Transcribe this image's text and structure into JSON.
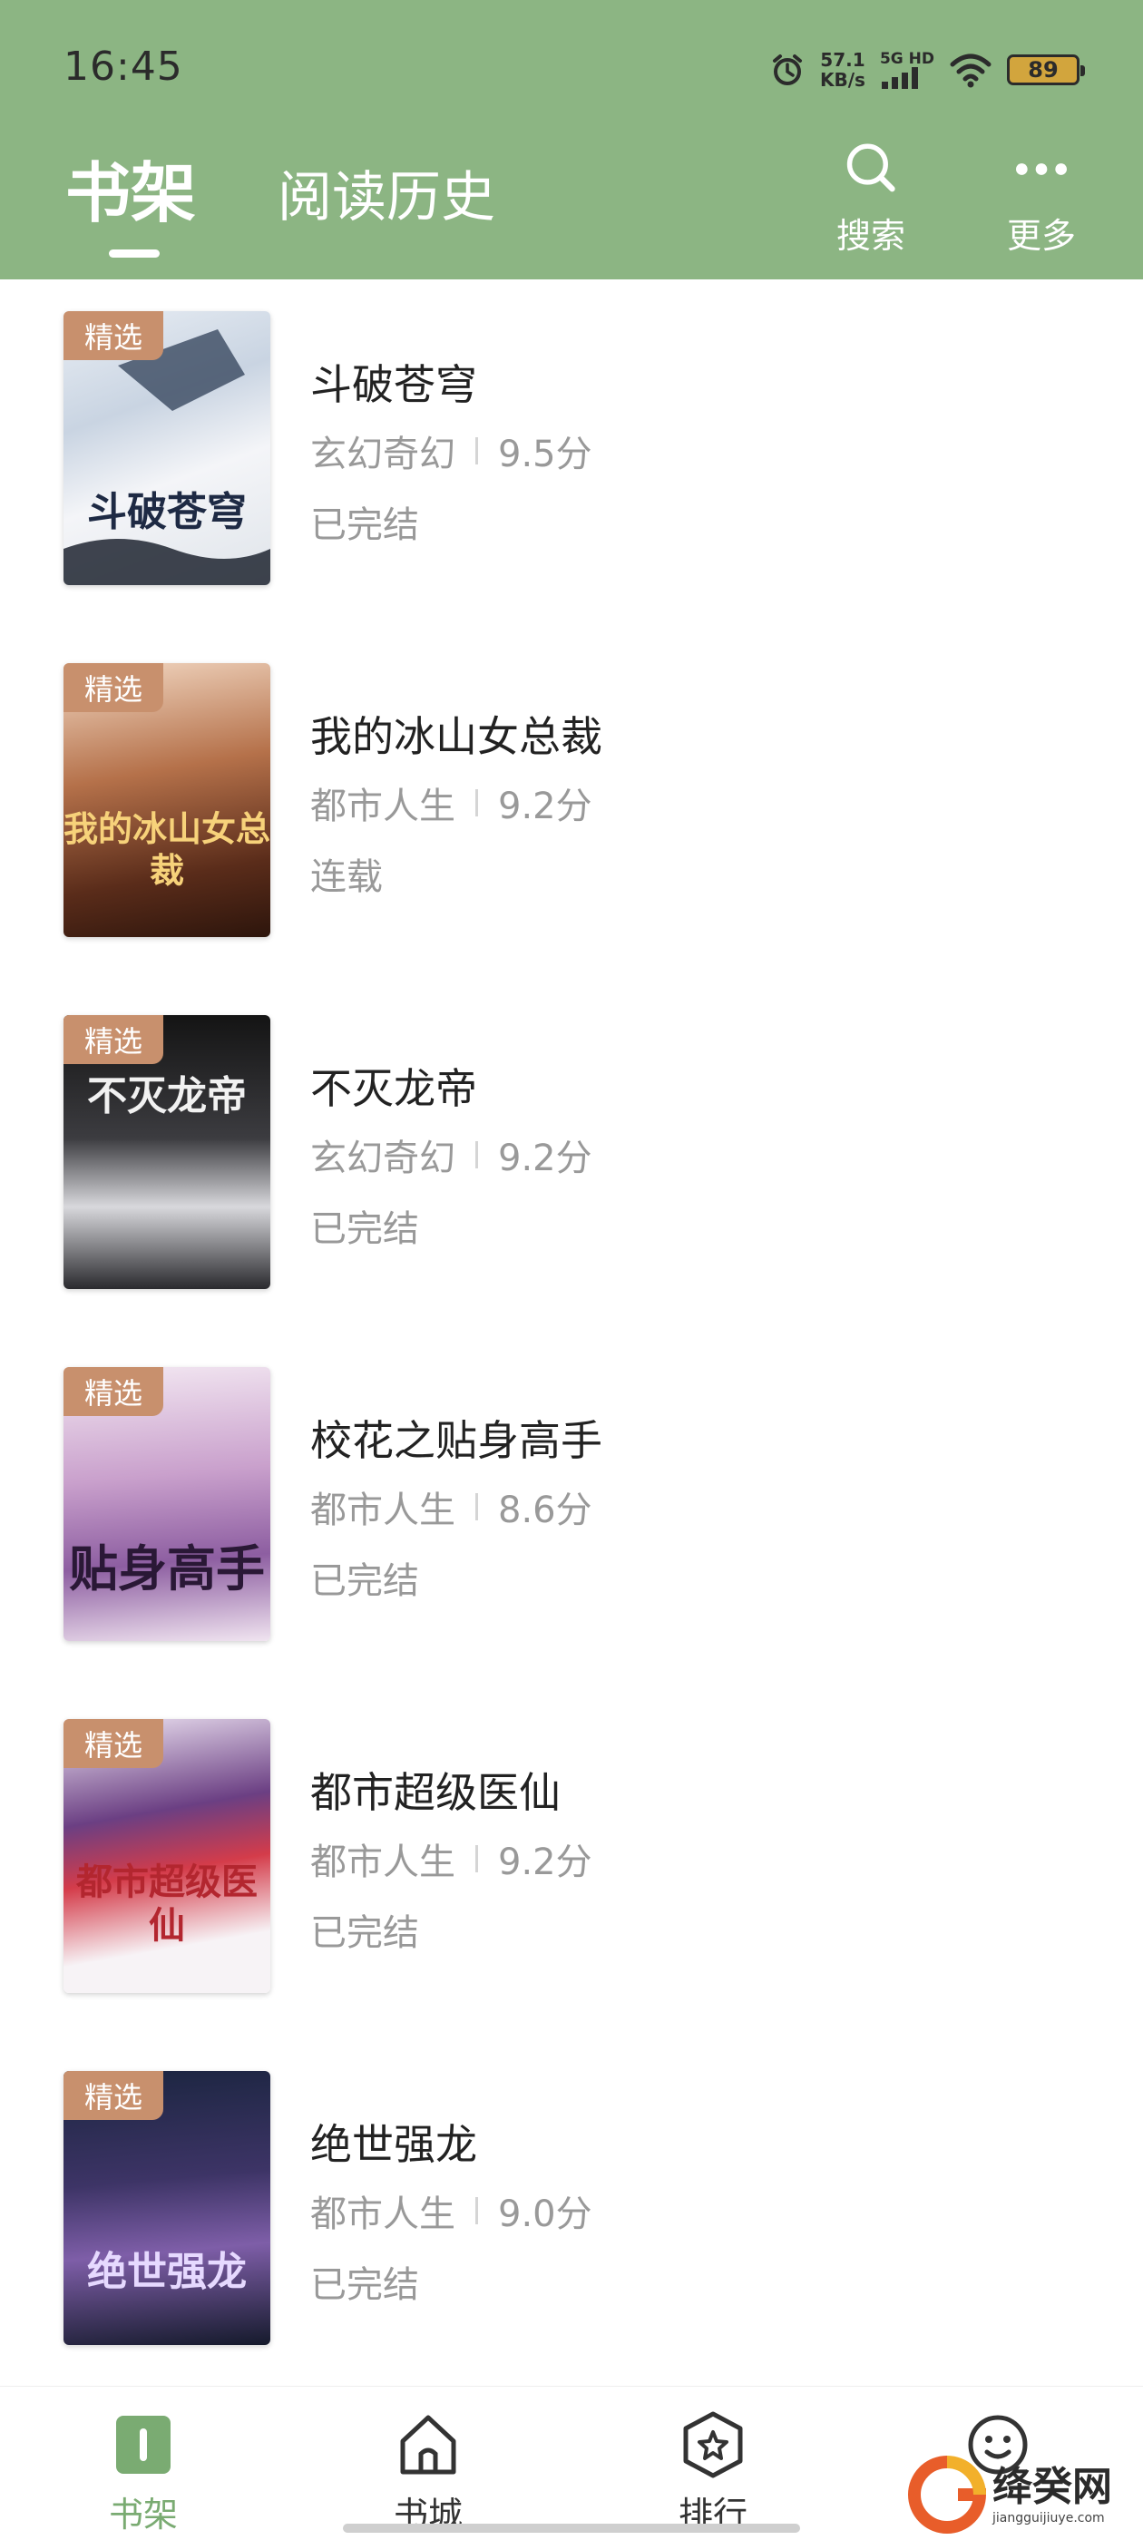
{
  "status_bar": {
    "time": "16:45",
    "net_speed_value": "57.1",
    "net_speed_unit": "KB/s",
    "signal_label": "5G HD",
    "battery": "89"
  },
  "header": {
    "tabs": [
      {
        "label": "书架",
        "active": true
      },
      {
        "label": "阅读历史",
        "active": false
      }
    ],
    "search_label": "搜索",
    "more_label": "更多",
    "accent_color": "#8cb583"
  },
  "books": [
    {
      "badge": "精选",
      "title": "斗破苍穹",
      "genre": "玄幻奇幻",
      "score": "9.5分",
      "status": "已完结",
      "cover_text": "斗破苍穹"
    },
    {
      "badge": "精选",
      "title": "我的冰山女总裁",
      "genre": "都市人生",
      "score": "9.2分",
      "status": "连载",
      "cover_text": "我的冰山女总裁"
    },
    {
      "badge": "精选",
      "title": "不灭龙帝",
      "genre": "玄幻奇幻",
      "score": "9.2分",
      "status": "已完结",
      "cover_text": "不灭龙帝"
    },
    {
      "badge": "精选",
      "title": "校花之贴身高手",
      "genre": "都市人生",
      "score": "8.6分",
      "status": "已完结",
      "cover_text": "贴身高手"
    },
    {
      "badge": "精选",
      "title": "都市超级医仙",
      "genre": "都市人生",
      "score": "9.2分",
      "status": "已完结",
      "cover_text": "都市超级医仙"
    },
    {
      "badge": "精选",
      "title": "绝世强龙",
      "genre": "都市人生",
      "score": "9.0分",
      "status": "已完结",
      "cover_text": "绝世强龙"
    }
  ],
  "bottom_nav": {
    "items": [
      {
        "label": "书架",
        "icon": "bookshelf-icon",
        "active": true
      },
      {
        "label": "书城",
        "icon": "home-icon",
        "active": false
      },
      {
        "label": "排行",
        "icon": "rank-star-icon",
        "active": false
      },
      {
        "label": "",
        "icon": "smiley-icon",
        "active": false
      }
    ],
    "active_color": "#7aab72"
  },
  "watermark": {
    "name": "绛癸网",
    "url": "jiangguijiuye.com"
  }
}
